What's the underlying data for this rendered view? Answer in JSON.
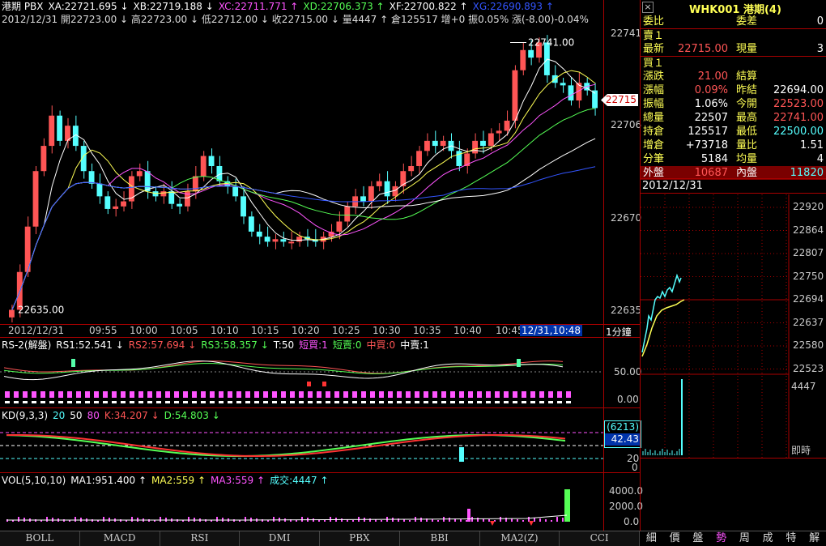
{
  "colors": {
    "up": "#ff5555",
    "down": "#55ffff",
    "white": "#ffffff",
    "yellow": "#ffff55",
    "magenta": "#ff55ff",
    "green": "#55ff55",
    "blue": "#3355ff",
    "frame": "#aa0000"
  },
  "header": {
    "line1": [
      {
        "t": "港期 PBX",
        "c": "#ffffff"
      },
      {
        "t": "XA:22721.695 ↓",
        "c": "#ffffff"
      },
      {
        "t": "XB:22719.188 ↓",
        "c": "#ffffff"
      },
      {
        "t": "XC:22711.771 ↑",
        "c": "#ff55ff"
      },
      {
        "t": "XD:22706.373 ↑",
        "c": "#55ff55"
      },
      {
        "t": "XF:22700.822 ↑",
        "c": "#ffffff"
      },
      {
        "t": "XG:22690.893 ↑",
        "c": "#3355ff"
      }
    ],
    "line2": "2012/12/31 開22723.00 ↓ 高22723.00 ↓ 低22712.00 ↓ 收22715.00 ↓ 量4447 ↑ 倉125517 增+0 振0.05% 漲(-8.00)-0.04%"
  },
  "main_chart": {
    "high_label": "22741.00",
    "low_label": "22635.00",
    "current_price": "22715",
    "y_ticks": [
      "22741",
      "22706",
      "22670",
      "22635"
    ],
    "x_ticks": [
      "2012/12/31",
      "09:55",
      "10:00",
      "10:05",
      "10:10",
      "10:15",
      "10:20",
      "10:25",
      "10:30",
      "10:35",
      "10:40",
      "10:45"
    ],
    "cursor_time": "12/31,10:48",
    "period": "1分鐘"
  },
  "rs_panel": {
    "title": "RS-2(解盤)",
    "items": [
      {
        "t": "RS1:52.541 ↓",
        "c": "#ffffff"
      },
      {
        "t": "RS2:57.694 ↓",
        "c": "#ff5555"
      },
      {
        "t": "RS3:58.357 ↓",
        "c": "#55ff55"
      },
      {
        "t": "T:50",
        "c": "#ffffff"
      },
      {
        "t": "短買:1",
        "c": "#ff55ff"
      },
      {
        "t": "短賣:0",
        "c": "#55ff55"
      },
      {
        "t": "中買:0",
        "c": "#ff5555"
      },
      {
        "t": "中賣:1",
        "c": "#ffffff"
      }
    ],
    "y_ticks": [
      "50.00",
      "0.00"
    ]
  },
  "kd_panel": {
    "title": "KD(9,3,3)",
    "items": [
      {
        "t": "20",
        "c": "#55ffff"
      },
      {
        "t": "50",
        "c": "#ffffff"
      },
      {
        "t": "80",
        "c": "#ff55ff"
      },
      {
        "t": "K:34.207 ↓",
        "c": "#ff5555"
      },
      {
        "t": "D:54.803 ↓",
        "c": "#55ff55"
      }
    ],
    "box_top": "(6213)",
    "box_val": "42.43",
    "y_ticks": [
      "20",
      "0"
    ]
  },
  "vol_panel": {
    "title": "VOL(5,10,10)",
    "items": [
      {
        "t": "MA1:951.400 ↑",
        "c": "#ffffff"
      },
      {
        "t": "MA2:559 ↑",
        "c": "#ffff55"
      },
      {
        "t": "MA3:559 ↑",
        "c": "#ff55ff"
      },
      {
        "t": "成交:4447 ↑",
        "c": "#55ffff"
      }
    ],
    "y_ticks": [
      "4000.0",
      "2000.0",
      "0.0"
    ]
  },
  "bottom_tabs": [
    "BOLL",
    "MACD",
    "RSI",
    "DMI",
    "PBX",
    "BBI",
    "MA2(Z)",
    "CCI"
  ],
  "side_tabs": [
    "細",
    "價",
    "盤",
    "勢",
    "周",
    "成",
    "特",
    "解"
  ],
  "quote": {
    "title": "WHK001 港期(4)",
    "rows": [
      {
        "l": "委比",
        "v": "",
        "l2": "委差",
        "v2": "0"
      },
      {
        "l": "賣１",
        "v": "",
        "l2": "",
        "v2": ""
      },
      {
        "l": "最新",
        "v": "22715.00",
        "l2": "現量",
        "v2": "3"
      },
      {
        "l": "買１",
        "v": "",
        "l2": "",
        "v2": ""
      },
      {
        "l": "漲跌",
        "v": "21.00",
        "l2": "結算",
        "v2": ""
      },
      {
        "l": "漲幅",
        "v": "0.09%",
        "l2": "昨結",
        "v2": "22694.00"
      },
      {
        "l": "振幅",
        "v": "1.06%",
        "l2": "今開",
        "v2": "22523.00"
      },
      {
        "l": "總量",
        "v": "22507",
        "l2": "最高",
        "v2": "22741.00"
      },
      {
        "l": "持倉",
        "v": "125517",
        "l2": "最低",
        "v2": "22500.00"
      },
      {
        "l": "增倉",
        "v": "+73718",
        "l2": "量比",
        "v2": "1.51"
      },
      {
        "l": "分筆",
        "v": "5184",
        "l2": "均量",
        "v2": "4"
      },
      {
        "l": "外盤",
        "v": "10687",
        "l2": "內盤",
        "v2": "11820"
      }
    ],
    "date": "2012/12/31",
    "mini_ticks": [
      "22920",
      "22864",
      "22807",
      "22750",
      "22694",
      "22637",
      "22580",
      "22523"
    ],
    "mini_vol": "4447",
    "mini_label": "即時"
  }
}
